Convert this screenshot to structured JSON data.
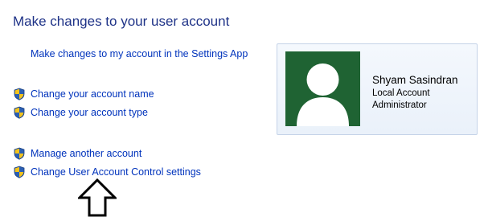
{
  "header": {
    "title": "Make changes to your user account"
  },
  "links": {
    "settings_app": "Make changes to my account in the Settings App",
    "change_name": "Change your account name",
    "change_type": "Change your account type",
    "manage_another": "Manage another account",
    "uac_settings": "Change User Account Control settings"
  },
  "account": {
    "name": "Shyam Sasindran",
    "account_type": "Local Account",
    "role": "Administrator"
  },
  "icons": {
    "link_icon": "uac-shield-icon",
    "avatar_icon": "user-avatar-icon",
    "pointer": "up-arrow-outline-icon"
  },
  "colors": {
    "title": "#1e3287",
    "link": "#0033bc",
    "avatar_background": "#1f6333",
    "card_border": "#c5d3e8"
  }
}
